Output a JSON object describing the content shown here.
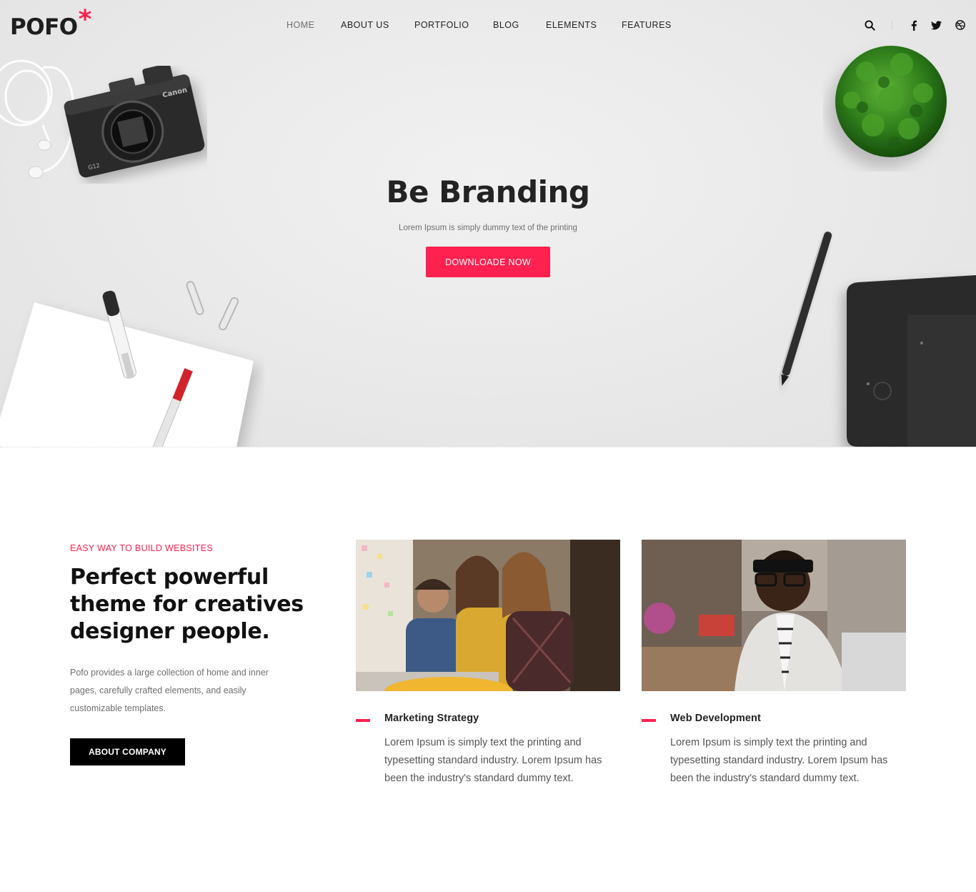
{
  "brand": {
    "logo_text": "POFO",
    "logo_mark": "*",
    "accent_color": "#ff214f"
  },
  "nav": {
    "items": [
      {
        "label": "HOME",
        "active": true
      },
      {
        "label": "ABOUT US",
        "active": false
      },
      {
        "label": "PORTFOLIO",
        "active": false
      },
      {
        "label": "BLOG",
        "active": false
      },
      {
        "label": "ELEMENTS",
        "active": false
      },
      {
        "label": "FEATURES",
        "active": false
      }
    ]
  },
  "header_icons": [
    "search-icon",
    "facebook-icon",
    "twitter-icon",
    "dribbble-icon"
  ],
  "hero": {
    "title": "Be Branding",
    "subtitle": "Lorem Ipsum is simply dummy text of the printing",
    "button_label": "DOWNLOADE NOW"
  },
  "about": {
    "eyebrow": "EASY WAY TO BUILD WEBSITES",
    "headline": "Perfect powerful theme for creatives designer people.",
    "intro": "Pofo provides a large collection of home and inner pages, carefully crafted elements, and easily customizable templates.",
    "button_label": "ABOUT COMPANY"
  },
  "services": [
    {
      "title": "Marketing Strategy",
      "text": "Lorem Ipsum is simply text the printing and typesetting standard industry. Lorem Ipsum has been the industry's standard dummy text."
    },
    {
      "title": "Web Development",
      "text": "Lorem Ipsum is simply text the printing and typesetting standard industry. Lorem Ipsum has been the industry's standard dummy text."
    }
  ]
}
